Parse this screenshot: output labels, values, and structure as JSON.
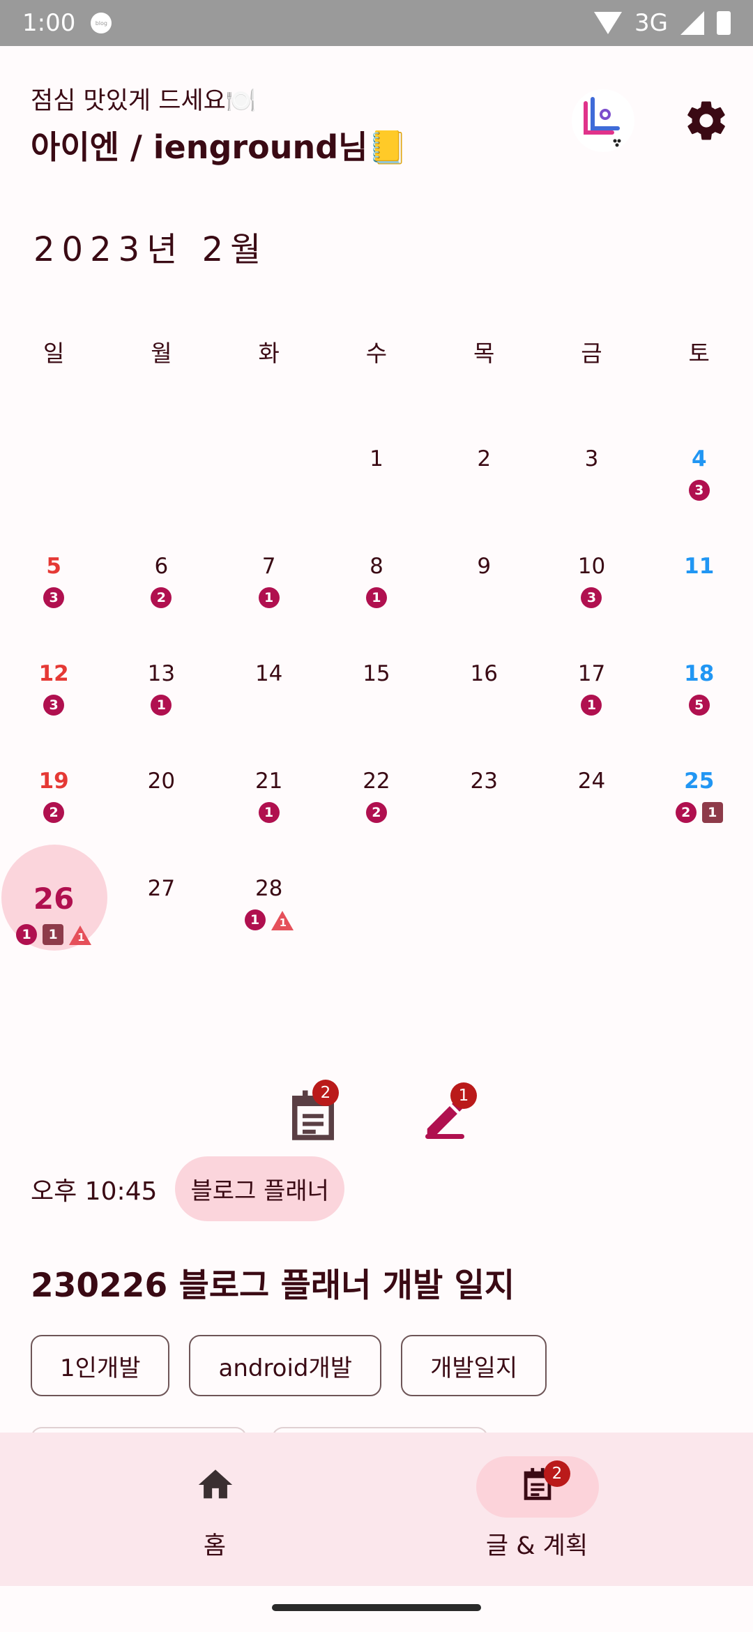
{
  "status_bar": {
    "time": "1:00",
    "app_icon_label": "blog",
    "network": "3G"
  },
  "header": {
    "greeting": "점심 맛있게 드세요🍽️",
    "user_title": "아이엔 / ienground님📒"
  },
  "calendar": {
    "month_title": "2023년 2월",
    "weekdays": [
      "일",
      "월",
      "화",
      "수",
      "목",
      "금",
      "토"
    ],
    "weeks": [
      [
        {
          "d": ""
        },
        {
          "d": ""
        },
        {
          "d": ""
        },
        {
          "d": "1",
          "c": ""
        },
        {
          "d": "2",
          "c": ""
        },
        {
          "d": "3",
          "c": ""
        },
        {
          "d": "4",
          "c": "3"
        }
      ],
      [
        {
          "d": "5",
          "c": "3"
        },
        {
          "d": "6",
          "c": "2"
        },
        {
          "d": "7",
          "c": "1"
        },
        {
          "d": "8",
          "c": "1"
        },
        {
          "d": "9",
          "c": ""
        },
        {
          "d": "10",
          "c": "3"
        },
        {
          "d": "11",
          "c": ""
        }
      ],
      [
        {
          "d": "12",
          "c": "3"
        },
        {
          "d": "13",
          "c": "1"
        },
        {
          "d": "14",
          "c": ""
        },
        {
          "d": "15",
          "c": ""
        },
        {
          "d": "16",
          "c": ""
        },
        {
          "d": "17",
          "c": "1"
        },
        {
          "d": "18",
          "c": "5"
        }
      ],
      [
        {
          "d": "19",
          "c": "2"
        },
        {
          "d": "20",
          "c": ""
        },
        {
          "d": "21",
          "c": "1"
        },
        {
          "d": "22",
          "c": "2"
        },
        {
          "d": "23",
          "c": ""
        },
        {
          "d": "24",
          "c": ""
        },
        {
          "d": "25",
          "c": "2",
          "s": "1"
        }
      ],
      [
        {
          "d": "26",
          "c": "1",
          "s": "1",
          "w": "1",
          "today": true
        },
        {
          "d": "27",
          "c": ""
        },
        {
          "d": "28",
          "c": "1",
          "w": "1"
        }
      ]
    ]
  },
  "tabs": {
    "posts_count": "2",
    "drafts_count": "1"
  },
  "post": {
    "time": "오후 10:45",
    "category": "블로그 플래너",
    "title": "230226 블로그 플래너 개발 일지",
    "tags": [
      "1인개발",
      "android개발",
      "개발일지"
    ]
  },
  "bottom_nav": {
    "home_label": "홈",
    "posts_label": "글 & 계획",
    "posts_badge": "2"
  },
  "colors": {
    "accent": "#b0104f",
    "sunday": "#e53935",
    "saturday": "#2196f3",
    "badge_red": "#ba1a1a",
    "nav_bg": "#fbe7ec"
  }
}
